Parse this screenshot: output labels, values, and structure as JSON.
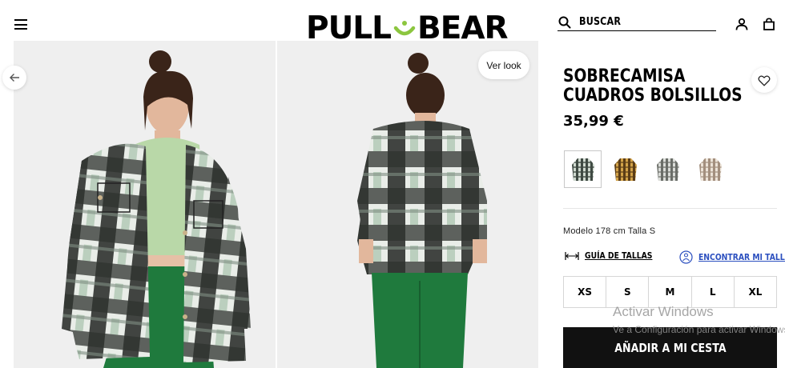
{
  "header": {
    "menu_icon": "hamburger-icon",
    "logo_text_left": "PULL",
    "logo_text_right": "BEAR",
    "search_label": "BUSCAR",
    "search_icon": "search-icon",
    "account_icon": "user-icon",
    "bag_icon": "shopping-bag-icon"
  },
  "gallery": {
    "prev_icon": "arrow-left-icon",
    "ver_look_label": "Ver look",
    "colors": {
      "plaid_dark": "#2f322f",
      "plaid_light": "#e9ede8",
      "plaid_green": "#a9c2ad",
      "top": "#b9d8a8",
      "pants": "#1f7a3d",
      "background": "#efefef"
    }
  },
  "product": {
    "title_line1": "SOBRECAMISA",
    "title_line2": "CUADROS BOLSILLOS",
    "price": "35,99 €",
    "wishlist_icon": "heart-icon",
    "swatches": [
      {
        "name": "verde-cuadros",
        "color": "#4f5f55",
        "selected": true
      },
      {
        "name": "mostaza-cuadros",
        "color": "#b7862e",
        "selected": false
      },
      {
        "name": "gris-cuadros",
        "color": "#9b9d99",
        "selected": false
      },
      {
        "name": "beige-cuadros",
        "color": "#d9cbbb",
        "selected": false
      }
    ],
    "model_info": "Modelo 178 cm Talla S",
    "size_guide_label": "GUÍA DE TALLAS",
    "size_guide_icon": "ruler-icon",
    "find_size_label": "ENCONTRAR MI TALLA",
    "find_size_icon": "person-circle-icon",
    "link_color": "#2b4fbf",
    "sizes": [
      "XS",
      "S",
      "M",
      "L",
      "XL"
    ],
    "add_to_cart_label": "AÑADIR A MI CESTA"
  },
  "watermark": {
    "title": "Activar Windows",
    "subtitle": "Ve a Configuración para activar Windows."
  }
}
